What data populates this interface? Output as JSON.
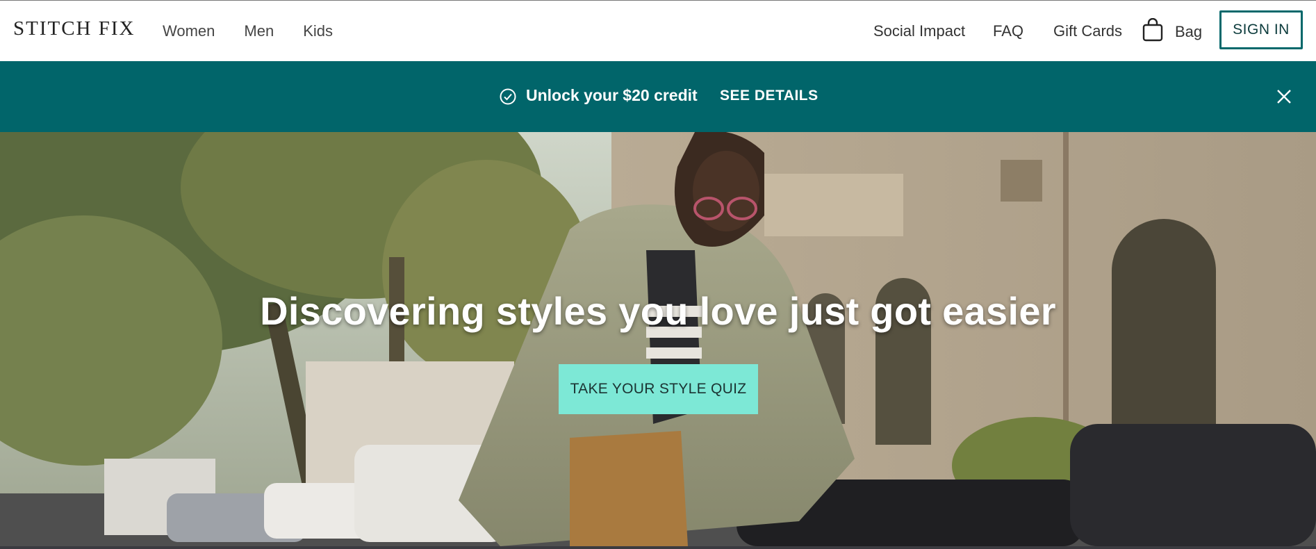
{
  "header": {
    "logo": "STITCH FIX",
    "nav_left": [
      "Women",
      "Men",
      "Kids"
    ],
    "social_impact": "Social Impact",
    "faq": "FAQ",
    "gift_cards": "Gift Cards",
    "bag": "Bag",
    "sign_in": "SIGN IN",
    "bag_icon": "shopping-bag-icon"
  },
  "banner": {
    "credit_text": "Unlock your $20 credit",
    "details_link": "SEE DETAILS",
    "check_icon": "check-circle-icon",
    "close_icon": "close-icon",
    "bg_color": "#01656a"
  },
  "hero": {
    "headline": "Discovering styles you love just got easier",
    "cta": "TAKE YOUR STYLE QUIZ",
    "cta_color": "#7de8d6"
  }
}
